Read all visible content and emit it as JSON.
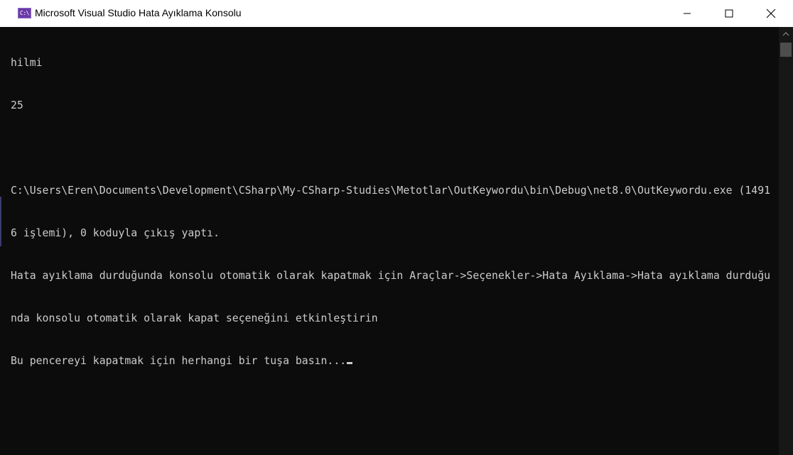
{
  "window": {
    "title": "Microsoft Visual Studio Hata Ayıklama Konsolu",
    "app_icon_text": "C:\\",
    "icon": "console-app-icon",
    "accent_color": "#6a3aa8",
    "buttons": {
      "minimize": "minimize-icon",
      "maximize": "maximize-icon",
      "close": "close-icon"
    }
  },
  "console": {
    "background": "#0c0c0c",
    "foreground": "#cccccc",
    "lines": [
      "hilmi",
      "25",
      "",
      "C:\\Users\\Eren\\Documents\\Development\\CSharp\\My-CSharp-Studies\\Metotlar\\OutKeywordu\\bin\\Debug\\net8.0\\OutKeywordu.exe (1491",
      "6 işlemi), 0 koduyla çıkış yaptı.",
      "Hata ayıklama durduğunda konsolu otomatik olarak kapatmak için Araçlar->Seçenekler->Hata Ayıklama->Hata ayıklama durduğu",
      "nda konsolu otomatik olarak kapat seçeneğini etkinleştirin",
      "Bu pencereyi kapatmak için herhangi bir tuşa basın..."
    ]
  },
  "scrollbar": {
    "up_icon": "scroll-up-arrow-icon"
  }
}
